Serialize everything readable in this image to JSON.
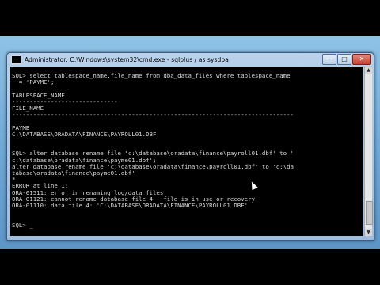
{
  "window": {
    "title": "Administrator: C:\\Windows\\system32\\cmd.exe - sqlplus  / as sysdba",
    "minimize_glyph": "–",
    "maximize_glyph": "□",
    "close_glyph": "✕"
  },
  "console": {
    "lines": [
      "",
      "SQL> select tablespace_name,file_name from dba_data_files where tablespace_name",
      "  = 'PAYME';",
      "",
      "TABLESPACE_NAME",
      "------------------------------",
      "FILE_NAME",
      "--------------------------------------------------------------------------------",
      "",
      "PAYME",
      "C:\\DATABASE\\ORADATA\\FINANCE\\PAYROLL01.DBF",
      "",
      "",
      "SQL> alter database rename file 'c:\\database\\oradata\\finance\\payroll01.dbf' to '",
      "c:\\database\\oradata\\finance\\payme01.dbf';",
      "alter database rename file 'c:\\database\\oradata\\finance\\payroll01.dbf' to 'c:\\da",
      "tabase\\oradata\\finance\\payme01.dbf'",
      "*",
      "ERROR at line 1:",
      "ORA-01511: error in renaming log/data files",
      "ORA-01121: cannot rename database file 4 - file is in use or recovery",
      "ORA-01110: data file 4: 'C:\\DATABASE\\ORADATA\\FINANCE\\PAYROLL01.DBF'",
      "",
      "",
      "SQL> _"
    ]
  },
  "colors": {
    "console_bg": "#000000",
    "console_fg": "#d8d8d8",
    "titlebar": "#b9d1ea"
  }
}
